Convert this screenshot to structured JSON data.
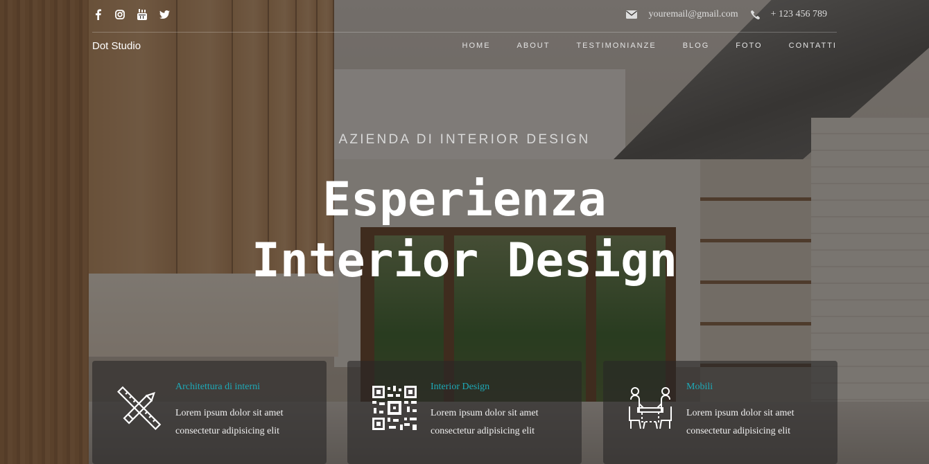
{
  "topbar": {
    "socials": [
      {
        "icon": "facebook-icon"
      },
      {
        "icon": "instagram-icon"
      },
      {
        "icon": "youtube-icon"
      },
      {
        "icon": "twitter-icon"
      }
    ],
    "email": "youremail@gmail.com",
    "email_icon": "envelope-icon",
    "phone": "+ 123 456 789",
    "phone_icon": "phone-icon"
  },
  "nav": {
    "brand": "Dot Studio",
    "items": [
      "HOME",
      "ABOUT",
      "TESTIMONIANZE",
      "BLOG",
      "FOTO",
      "CONTATTI"
    ]
  },
  "hero": {
    "eyebrow": "AZIENDA DI INTERIOR DESIGN",
    "headline_line1": "Esperienza",
    "headline_line2": "Interior Design"
  },
  "features": [
    {
      "icon": "pencil-ruler-icon",
      "title": "Architettura di interni",
      "desc": "Lorem ipsum dolor sit amet consectetur adipisicing elit"
    },
    {
      "icon": "qr-code-icon",
      "title": "Interior Design",
      "desc": "Lorem ipsum dolor sit amet consectetur adipisicing elit"
    },
    {
      "icon": "dining-table-icon",
      "title": "Mobili",
      "desc": "Lorem ipsum dolor sit amet consectetur adipisicing elit"
    }
  ],
  "colors": {
    "accent": "#1eaab8",
    "overlay": "#161210"
  }
}
